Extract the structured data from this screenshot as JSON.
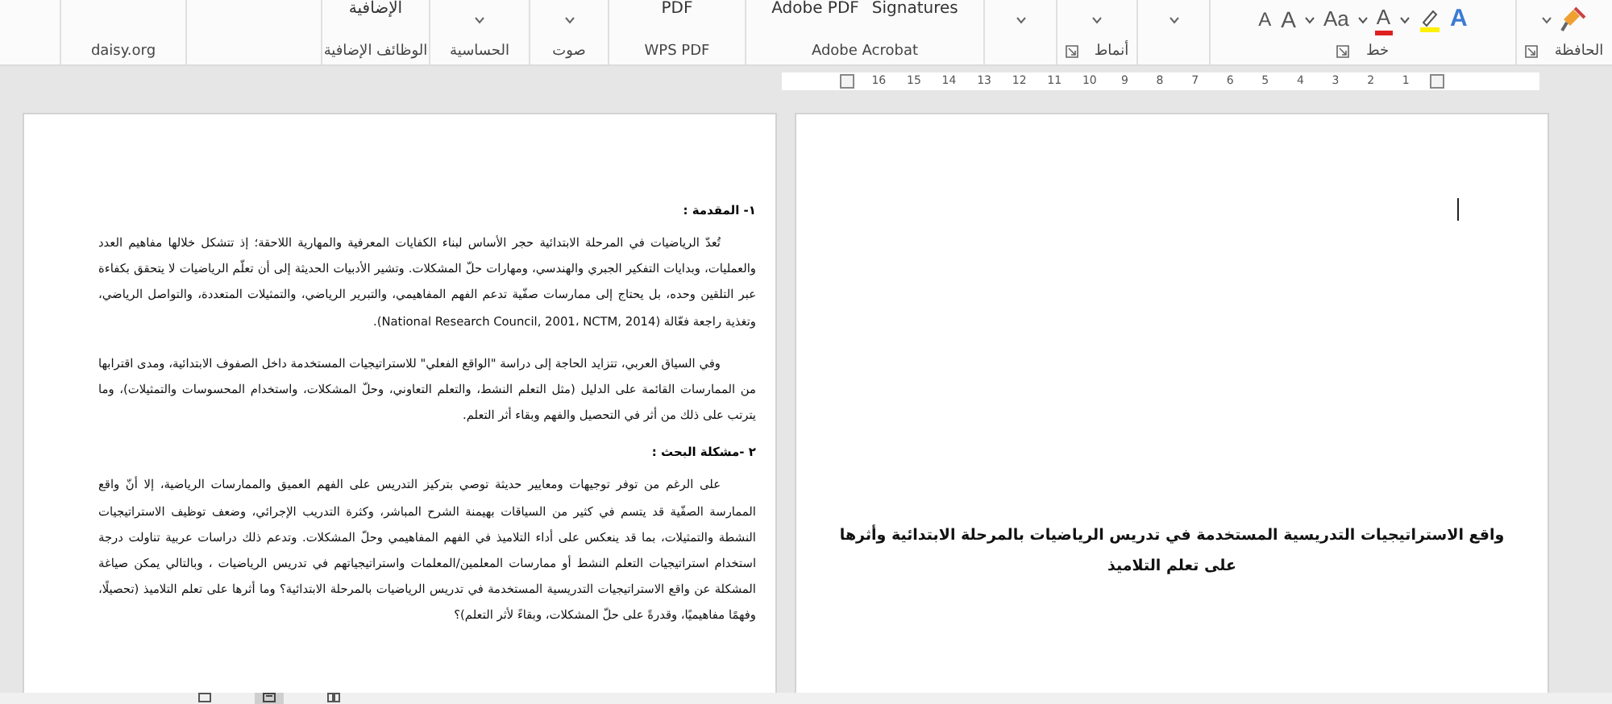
{
  "ribbon": {
    "groups": [
      {
        "kind": "clipboard",
        "label": "الحافظة",
        "launcher": true,
        "dropdown": true
      },
      {
        "kind": "font",
        "label": "خط",
        "launcher": true,
        "dropdown": false,
        "tools": [
          {
            "kind": "effects",
            "glyph": "A"
          },
          {
            "kind": "highlight"
          },
          {
            "kind": "font-color",
            "glyph": "A"
          },
          {
            "kind": "case",
            "glyph": "Aa"
          },
          {
            "kind": "grow",
            "glyph": "A"
          },
          {
            "kind": "shrink",
            "glyph": "A"
          }
        ]
      },
      {
        "kind": "plain",
        "launcher": false,
        "dropdown": true
      },
      {
        "kind": "plain",
        "label": "أنماط",
        "launcher": true,
        "dropdown": true
      },
      {
        "kind": "plain",
        "launcher": false,
        "dropdown": true
      },
      {
        "kind": "plain",
        "label": "Adobe Acrobat",
        "launcher": false,
        "dropdown": false,
        "buttons": [
          "Signatures",
          "Adobe PDF"
        ]
      },
      {
        "kind": "plain",
        "label": "WPS PDF",
        "launcher": false,
        "dropdown": false,
        "buttons": [
          "PDF"
        ]
      },
      {
        "kind": "plain",
        "label": "صوت",
        "launcher": false,
        "dropdown": true
      },
      {
        "kind": "plain",
        "label": "الحساسية",
        "launcher": false,
        "dropdown": true
      },
      {
        "kind": "plain",
        "label": "الوظائف الإضافية",
        "launcher": false,
        "dropdown": false,
        "buttons": [
          "الإضافية"
        ]
      },
      {
        "kind": "plain",
        "launcher": false,
        "dropdown": false
      },
      {
        "kind": "plain",
        "label": "daisy.org",
        "launcher": false,
        "dropdown": false
      }
    ]
  },
  "ruler": {
    "numbers": [
      "1",
      "2",
      "3",
      "4",
      "5",
      "6",
      "7",
      "8",
      "9",
      "10",
      "11",
      "12",
      "13",
      "14",
      "15",
      "16"
    ]
  },
  "left_page": {
    "blocks": [
      {
        "kind": "heading",
        "text": "١- المقدمة :"
      },
      {
        "kind": "paragraph",
        "text": "تُعدّ الرياضيات في المرحلة الابتدائية حجر الأساس لبناء الكفايات المعرفية والمهارية اللاحقة؛ إذ تتشكل خلالها مفاهيم العدد والعمليات، وبدايات التفكير الجبري والهندسي، ومهارات حلّ المشكلات. وتشير الأدبيات الحديثة إلى أن تعلّم الرياضيات لا يتحقق بكفاءة عبر التلقين وحده، بل يحتاج إلى ممارسات صفّية تدعم الفهم المفاهيمي، والتبرير الرياضي، والتمثيلات المتعددة، والتواصل الرياضي، وتغذية راجعة فعّالة (National Research Council, 2001، NCTM, 2014)."
      },
      {
        "kind": "paragraph",
        "text": "وفي السياق العربي، تتزايد الحاجة إلى دراسة \"الواقع الفعلي\" للاستراتيجيات المستخدمة داخل الصفوف الابتدائية، ومدى اقترابها من الممارسات القائمة على الدليل (مثل التعلم النشط، والتعلم التعاوني، وحلّ المشكلات، واستخدام المحسوسات والتمثيلات)، وما يترتب على ذلك من أثر في التحصيل والفهم وبقاء أثر التعلم."
      },
      {
        "kind": "heading",
        "text": "٢ -مشكلة البحث :"
      },
      {
        "kind": "paragraph",
        "text": "على الرغم من توفر توجيهات ومعايير حديثة توصي بتركيز التدريس على الفهم العميق والممارسات الرياضية، إلا أنّ واقع الممارسة الصفّية قد يتسم في كثير من السياقات بهيمنة الشرح المباشر، وكثرة التدريب الإجرائي، وضعف توظيف الاستراتيجيات النشطة والتمثيلات، بما قد ينعكس على أداء التلاميذ في الفهم المفاهيمي وحلّ المشكلات. وتدعم ذلك دراسات عربية تناولت درجة استخدام استراتيجيات التعلم النشط أو ممارسات المعلمين/المعلمات واستراتيجياتهم في تدريس الرياضيات ، وبالتالي يمكن صياغة المشكلة عن واقع الاستراتيجيات التدريسية المستخدمة في تدريس الرياضيات بالمرحلة الابتدائية؟ وما أثرها على تعلم التلاميذ (تحصيلًا، وفهمًا مفاهيميًا، وقدرةً على حلّ المشكلات، وبقاءً لأثر التعلم)؟"
      }
    ]
  },
  "right_page": {
    "title_lines": [
      "واقع الاستراتيجيات التدريسية المستخدمة في تدريس الرياضيات بالمرحلة الابتدائية وأثرها",
      "على تعلم التلاميذ"
    ]
  },
  "status_bar": {
    "views": [
      {
        "kind": "read",
        "selected": false
      },
      {
        "kind": "print",
        "selected": true
      },
      {
        "kind": "web",
        "selected": false
      }
    ]
  }
}
